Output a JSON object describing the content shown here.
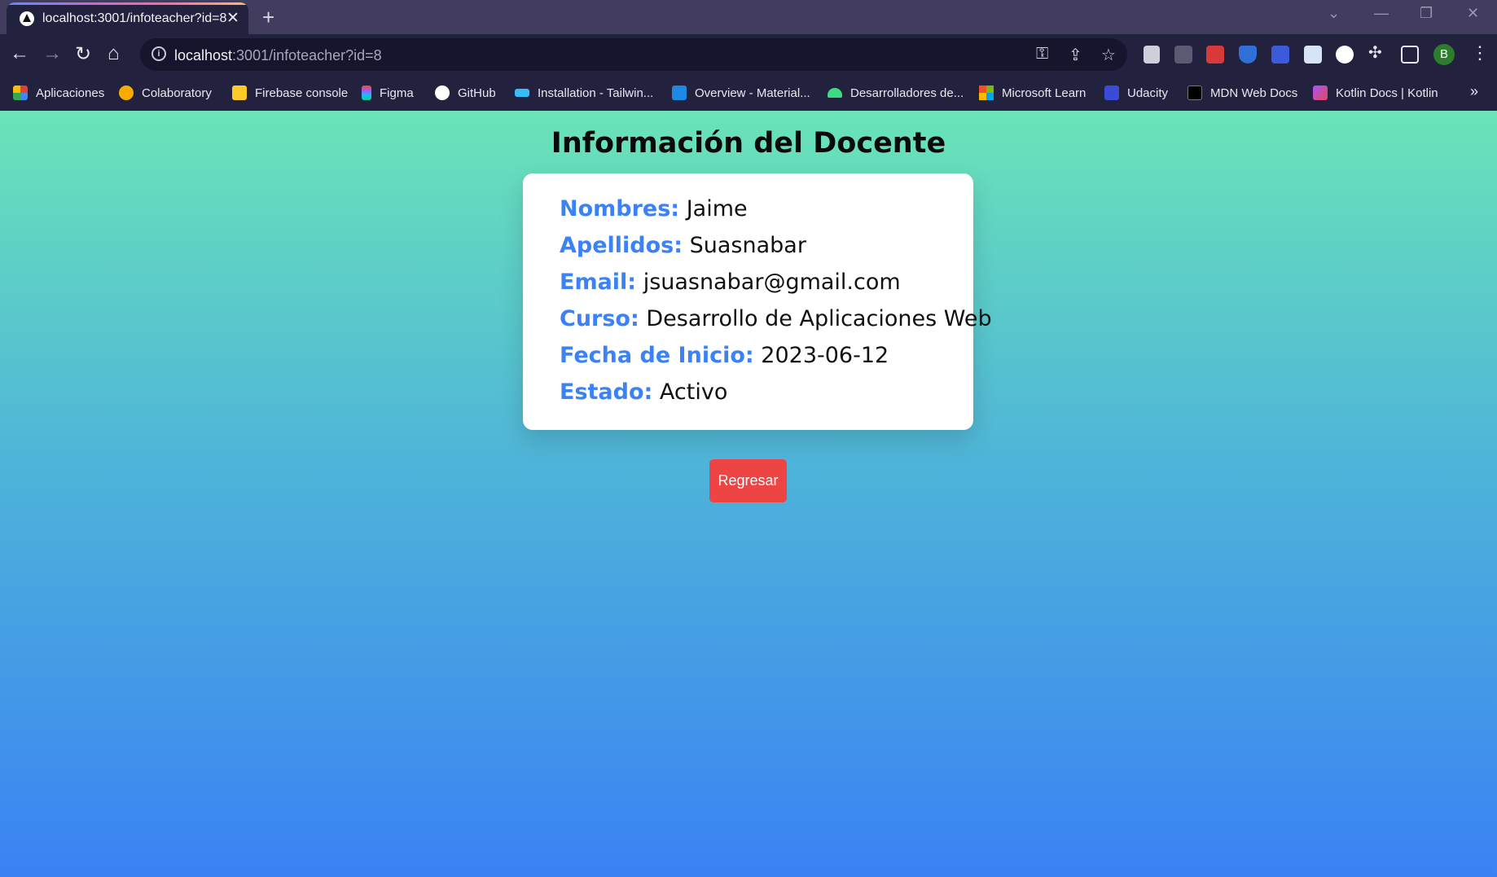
{
  "browser": {
    "tab": {
      "title": "localhost:3001/infoteacher?id=8"
    },
    "url": {
      "host": "localhost",
      "rest": ":3001/infoteacher?id=8"
    },
    "profile_initial": "B",
    "bookmarks": [
      {
        "label": "Aplicaciones",
        "icon": "apps-grid-icon",
        "color": "#e34133"
      },
      {
        "label": "Colaboratory",
        "icon": "colab-icon",
        "color": "#f9ab00"
      },
      {
        "label": "Firebase console",
        "icon": "firebase-icon",
        "color": "#ffca28"
      },
      {
        "label": "Figma",
        "icon": "figma-icon",
        "color": "#f24e1e"
      },
      {
        "label": "GitHub",
        "icon": "github-icon",
        "color": "#ffffff"
      },
      {
        "label": "Installation - Tailwin...",
        "icon": "tailwind-icon",
        "color": "#38bdf8"
      },
      {
        "label": "Overview - Material...",
        "icon": "material-ui-icon",
        "color": "#1e88e5"
      },
      {
        "label": "Desarrolladores de...",
        "icon": "android-icon",
        "color": "#3ddc84"
      },
      {
        "label": "Microsoft Learn",
        "icon": "microsoft-icon",
        "color": "#f25022"
      },
      {
        "label": "Udacity",
        "icon": "udacity-icon",
        "color": "#3b4bd8"
      },
      {
        "label": "MDN Web Docs",
        "icon": "mdn-icon",
        "color": "#000000"
      },
      {
        "label": "Kotlin Docs | Kotlin",
        "icon": "kotlin-icon",
        "color": "#a855f7"
      }
    ]
  },
  "page": {
    "title": "Información del Docente",
    "fields": [
      {
        "label": "Nombres:",
        "value": "Jaime"
      },
      {
        "label": "Apellidos:",
        "value": "Suasnabar"
      },
      {
        "label": "Email:",
        "value": "jsuasnabar@gmail.com"
      },
      {
        "label": "Curso:",
        "value": "Desarrollo de Aplicaciones Web"
      },
      {
        "label": "Fecha de Inicio:",
        "value": "2023-06-12"
      },
      {
        "label": "Estado:",
        "value": "Activo"
      }
    ],
    "back_button": "Regresar"
  },
  "colors": {
    "label": "#3b82f6",
    "button": "#ef4444",
    "gradient_top": "#6ae4b8",
    "gradient_bottom": "#3a82f4"
  }
}
